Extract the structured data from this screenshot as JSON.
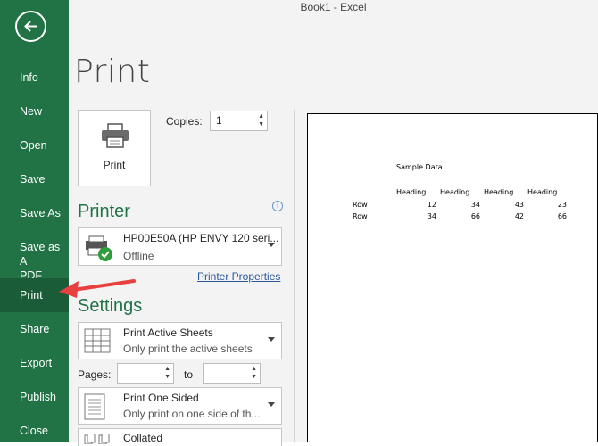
{
  "window": {
    "title": "Book1  -  Excel"
  },
  "sidebar": {
    "items": [
      {
        "label": "Info"
      },
      {
        "label": "New"
      },
      {
        "label": "Open"
      },
      {
        "label": "Save"
      },
      {
        "label": "Save As"
      },
      {
        "label": "Save as Adobe PDF"
      },
      {
        "label": "Print"
      },
      {
        "label": "Share"
      },
      {
        "label": "Export"
      },
      {
        "label": "Publish"
      },
      {
        "label": "Close"
      }
    ],
    "save_as_pdf_line1": "Save as A",
    "save_as_pdf_line2": "PDF"
  },
  "print": {
    "title": "Print",
    "button_label": "Print",
    "copies_label": "Copies:",
    "copies_value": "1"
  },
  "printer": {
    "heading": "Printer",
    "name": "HP00E50A (HP ENVY 120 seri...",
    "status": "Offline",
    "properties_link": "Printer Properties"
  },
  "settings": {
    "heading": "Settings",
    "active_sheets": {
      "main": "Print Active Sheets",
      "sub": "Only print the active sheets"
    },
    "pages_label": "Pages:",
    "pages_from": "",
    "to_label": "to",
    "pages_to": "",
    "sided": {
      "main": "Print One Sided",
      "sub": "Only print on one side of th..."
    },
    "collated": {
      "main": "Collated"
    }
  },
  "preview": {
    "title": "Sample Data",
    "headers": [
      "Heading",
      "Heading",
      "Heading",
      "Heading"
    ],
    "rows": [
      {
        "label": "Row",
        "values": [
          "12",
          "34",
          "43",
          "23"
        ]
      },
      {
        "label": "Row",
        "values": [
          "34",
          "66",
          "42",
          "66"
        ]
      }
    ]
  },
  "annotation": {
    "arrow_color": "#e8403f"
  },
  "colors": {
    "accent": "#217346"
  }
}
